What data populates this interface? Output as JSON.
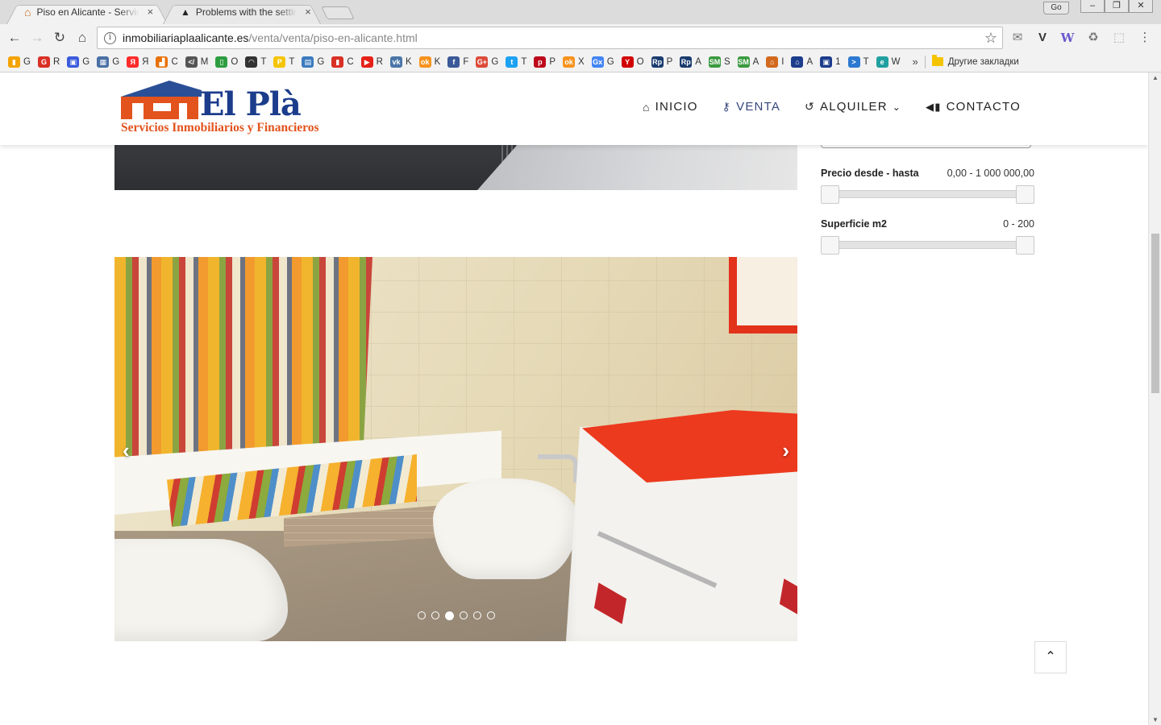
{
  "browser": {
    "tabs": [
      {
        "title": "Piso en Alicante - Servicios Inmobiliarios",
        "close": "×",
        "favicon": "house-icon"
      },
      {
        "title": "Problems with the settings",
        "close": "×",
        "favicon": "a-logo-icon"
      }
    ],
    "window_controls": {
      "user": "Go",
      "minimize": "–",
      "restore": "❐",
      "close": "✕"
    },
    "url": {
      "host": "inmobiliariaplaalicante.es",
      "path": "/venta/venta/piso-en-alicante.html"
    },
    "bookmarks": [
      {
        "label": "G",
        "color": "#f4a300",
        "glyph": "▮"
      },
      {
        "label": "R",
        "color": "#d93025",
        "glyph": "G"
      },
      {
        "label": "G",
        "color": "#3b5bdb",
        "glyph": "▣"
      },
      {
        "label": "G",
        "color": "#4a6fa5",
        "glyph": "▦"
      },
      {
        "label": "Я",
        "color": "#ff2b2b",
        "glyph": "Я"
      },
      {
        "label": "C",
        "color": "#e8710a",
        "glyph": "▟"
      },
      {
        "label": "M",
        "color": "#555555",
        "glyph": "</"
      },
      {
        "label": "O",
        "color": "#2e9d3f",
        "glyph": "▯"
      },
      {
        "label": "T",
        "color": "#333333",
        "glyph": "◠"
      },
      {
        "label": "T",
        "color": "#f5c400",
        "glyph": "P"
      },
      {
        "label": "G",
        "color": "#3b7bbf",
        "glyph": "▤"
      },
      {
        "label": "C",
        "color": "#d93025",
        "glyph": "▮"
      },
      {
        "label": "R",
        "color": "#e62117",
        "glyph": "▶"
      },
      {
        "label": "K",
        "color": "#4a76a8",
        "glyph": "vk"
      },
      {
        "label": "K",
        "color": "#f7931e",
        "glyph": "ok"
      },
      {
        "label": "F",
        "color": "#3b5998",
        "glyph": "f"
      },
      {
        "label": "G",
        "color": "#dd4b39",
        "glyph": "G+"
      },
      {
        "label": "T",
        "color": "#1da1f2",
        "glyph": "t"
      },
      {
        "label": "P",
        "color": "#bd081c",
        "glyph": "p"
      },
      {
        "label": "X",
        "color": "#f7931e",
        "glyph": "ok"
      },
      {
        "label": "G",
        "color": "#4285f4",
        "glyph": "Gx"
      },
      {
        "label": "O",
        "color": "#d10000",
        "glyph": "Y"
      },
      {
        "label": "P",
        "color": "#1a3c6e",
        "glyph": "Rp"
      },
      {
        "label": "A",
        "color": "#1a3c6e",
        "glyph": "Rp"
      },
      {
        "label": "S",
        "color": "#3a9a3f",
        "glyph": "SM"
      },
      {
        "label": "A",
        "color": "#3a9a3f",
        "glyph": "SM"
      },
      {
        "label": "I",
        "color": "#d2691e",
        "glyph": "⌂"
      },
      {
        "label": "A",
        "color": "#1c3c8c",
        "glyph": "⌂"
      },
      {
        "label": "1",
        "color": "#1c3c8c",
        "glyph": "▣"
      },
      {
        "label": "T",
        "color": "#2b79d0",
        "glyph": ">"
      },
      {
        "label": "W",
        "color": "#20a0a0",
        "glyph": "e"
      }
    ],
    "bookmarks_more": "»",
    "other_bookmarks": "Другие закладки"
  },
  "site": {
    "logo": {
      "brand": "El Plà",
      "tagline": "Servicios Inmobiliarios y Financieros"
    },
    "nav": [
      {
        "label": "INICIO",
        "icon": "home-icon",
        "glyph": "⌂",
        "active": false
      },
      {
        "label": "VENTA",
        "icon": "key-icon",
        "glyph": "⚷",
        "active": true
      },
      {
        "label": "ALQUILER",
        "icon": "history-icon",
        "glyph": "↺",
        "active": false,
        "caret": "⌄"
      },
      {
        "label": "CONTACTO",
        "icon": "bullhorn-icon",
        "glyph": "📢",
        "active": false
      }
    ],
    "filters": {
      "price": {
        "label": "Precio desde - hasta",
        "range": "0,00 - 1 000 000,00",
        "min": 0,
        "max": 1.0
      },
      "area": {
        "label": "Superficie m2",
        "range": "0 - 200",
        "min": 0,
        "max": 1.0
      }
    },
    "carousel": {
      "slides": 6,
      "active_index": 2,
      "prev": "‹",
      "next": "›"
    },
    "to_top": "⌃"
  }
}
